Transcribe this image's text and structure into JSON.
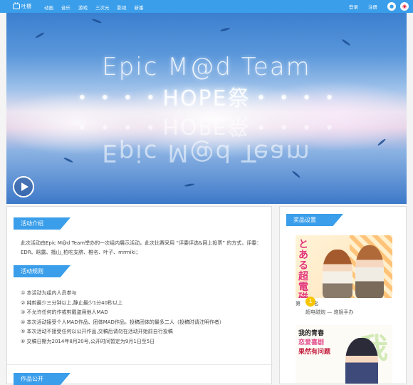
{
  "header": {
    "logo_text": "吐槽",
    "nav": [
      "动画",
      "音乐",
      "游戏",
      "三次元",
      "影视",
      "新番"
    ],
    "login": "登录",
    "register": "注册"
  },
  "banner": {
    "title_line1": "Epic M@d Team",
    "title_line2": "・・・・HOPE祭・・・・"
  },
  "intro": {
    "heading": "活动介绍",
    "text": "此次活动由Epic M@d Team举办的一次组内展示活动，此次比赛采用 “评委评选&网上投票” 的方式，评委：EDR、晗露、搔山_柏吃支脐、椎名、叶子、mrmiki；"
  },
  "rules": {
    "heading": "活动规则",
    "items": [
      "① 本活动为组内人员参与",
      "② 纯剪最少三分钟以上,静止最少1分40秒以上",
      "③ 不允许任何的作或剪戴盗用他人MAD",
      "④ 本次活动接受个人MAD作品、团体MAD作品。投稿团体的最多二人（投稿时请注明作者）",
      "⑤ 本次活动不接受任何以公开作品,交稿后请勿在活动开始前自行投稿",
      "⑥ 交稿日期为2014年8月20号,公开时间暂定为9月1日至5日"
    ]
  },
  "next_section": {
    "heading": "作品公开"
  },
  "prizes": {
    "heading": "奖品设置",
    "prize1_image_text": "とある超電磁砲",
    "prize1_rank_prefix": "第",
    "prize1_rank_num": "1",
    "prize1_rank_suffix": "名",
    "prize1_name": "超电磁炮 — 炮姐手办",
    "prize2_image_lines": [
      "我的青春",
      "恋爱喜剧",
      "果然有问题"
    ],
    "prize2_bg_char": "我"
  },
  "colors": {
    "accent": "#3a9eea",
    "badge": "#f7c400"
  }
}
